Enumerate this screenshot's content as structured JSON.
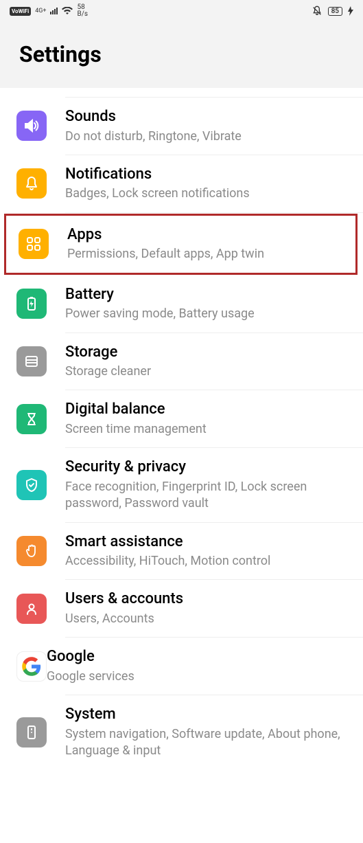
{
  "status": {
    "vowifi": "VoWiFi",
    "net": "4G+",
    "speed_num": "58",
    "speed_unit": "B/s",
    "battery": "85"
  },
  "header": {
    "title": "Settings"
  },
  "rows": {
    "sounds": {
      "title": "Sounds",
      "subtitle": "Do not disturb, Ringtone, Vibrate"
    },
    "notif": {
      "title": "Notifications",
      "subtitle": "Badges, Lock screen notifications"
    },
    "apps": {
      "title": "Apps",
      "subtitle": "Permissions, Default apps, App twin"
    },
    "battery": {
      "title": "Battery",
      "subtitle": "Power saving mode, Battery usage"
    },
    "storage": {
      "title": "Storage",
      "subtitle": "Storage cleaner"
    },
    "digital": {
      "title": "Digital balance",
      "subtitle": "Screen time management"
    },
    "security": {
      "title": "Security & privacy",
      "subtitle": "Face recognition, Fingerprint ID, Lock screen password, Password vault"
    },
    "smart": {
      "title": "Smart assistance",
      "subtitle": "Accessibility, HiTouch, Motion control"
    },
    "users": {
      "title": "Users & accounts",
      "subtitle": "Users, Accounts"
    },
    "google": {
      "title": "Google",
      "subtitle": "Google services"
    },
    "system": {
      "title": "System",
      "subtitle": "System navigation, Software update, About phone, Language & input"
    }
  }
}
